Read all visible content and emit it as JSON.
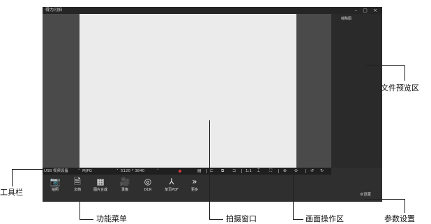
{
  "app": {
    "title": "得力闪拍",
    "window_buttons": {
      "minimize": "–",
      "maximize": "▢",
      "close": "×"
    },
    "preview_title": "缩略图"
  },
  "toolbar": {
    "device": "USB 视频设备",
    "format": "MJPG",
    "resolution": "5120 * 3840",
    "ratio": "1:1",
    "dropdown_glyph": "˅"
  },
  "menu": [
    {
      "label": "拍照",
      "icon": "camera-icon",
      "glyph": "📷"
    },
    {
      "label": "文档",
      "icon": "document-icon",
      "glyph": "🗎"
    },
    {
      "label": "图片合成",
      "icon": "image-merge-icon",
      "glyph": "▦"
    },
    {
      "label": "录像",
      "icon": "video-icon",
      "glyph": "🎥"
    },
    {
      "label": "OCR",
      "icon": "ocr-icon",
      "glyph": "◎"
    },
    {
      "label": "单页PDF",
      "icon": "pdf-icon",
      "glyph": "⅄"
    },
    {
      "label": "更多",
      "icon": "more-icon",
      "glyph": "»"
    }
  ],
  "settings_label": "设置",
  "callouts": {
    "file_preview": "文件预览区",
    "toolbar": "工具栏",
    "function_menu": "功能菜单",
    "capture_window": "拍摄窗口",
    "canvas_ops": "画面操作区",
    "param_settings": "参数设置"
  },
  "colors": {
    "record": "#d93a3a",
    "app_bg": "#2f2f2f",
    "capture_bg": "#ebebeb"
  }
}
